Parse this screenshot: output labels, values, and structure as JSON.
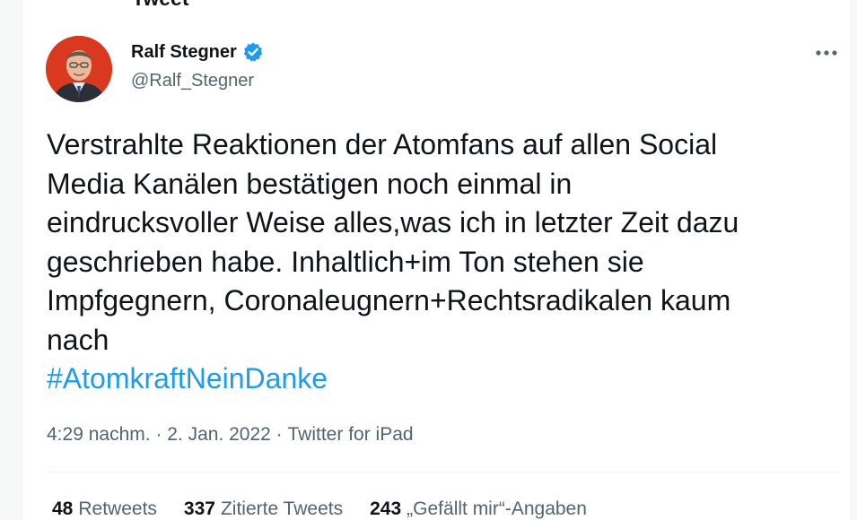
{
  "header": {
    "title": "Tweet"
  },
  "author": {
    "name": "Ralf Stegner",
    "handle": "@Ralf_Stegner",
    "verified_icon": "verified-badge-icon",
    "verified_color": "#1d9bf0",
    "avatar_background": "#d93a1f"
  },
  "tweet": {
    "text": "Verstrahlte Reaktionen der Atomfans auf allen Social\nMedia Kanälen bestätigen noch einmal in\neindrucksvoller Weise alles,was ich in letzter Zeit dazu\ngeschrieben habe. Inhaltlich+im Ton stehen sie\nImpfgegnern, Coronaleugnern+Rechtsradikalen kaum\nnach",
    "hashtag": "#AtomkraftNeinDanke",
    "hashtag_color": "#1d9bf0"
  },
  "meta": {
    "time": "4:29 nachm.",
    "separator": " · ",
    "date": "2. Jan. 2022",
    "source": "Twitter for iPad"
  },
  "stats": {
    "retweets_count": "48",
    "retweets_label": "Retweets",
    "quotes_count": "337",
    "quotes_label": "Zitierte Tweets",
    "likes_count": "243",
    "likes_label": "„Gefällt mir“-Angaben"
  },
  "icons": {
    "more": "more-horizontal-icon"
  }
}
